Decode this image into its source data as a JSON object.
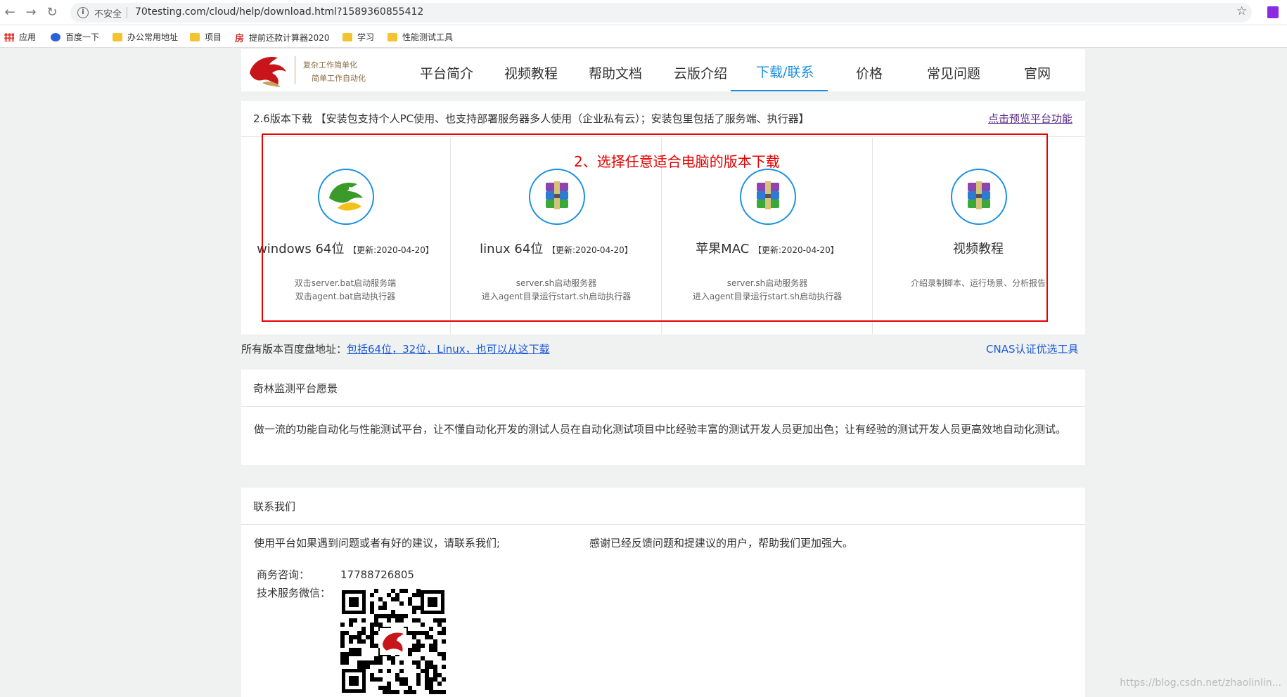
{
  "browser": {
    "security_label": "不安全",
    "url": "70testing.com/cloud/help/download.html?1589360855412"
  },
  "bookmarks": [
    {
      "label": "应用",
      "icon": "apps-grid-icon"
    },
    {
      "label": "百度一下",
      "icon": "baidu-paw-icon"
    },
    {
      "label": "办公常用地址",
      "icon": "folder-icon"
    },
    {
      "label": "项目",
      "icon": "folder-icon"
    },
    {
      "label": "提前还款计算器2020",
      "icon": "fang-icon"
    },
    {
      "label": "学习",
      "icon": "folder-icon"
    },
    {
      "label": "性能测试工具",
      "icon": "folder-icon"
    }
  ],
  "logo": {
    "line1": "复杂工作简单化",
    "line2": "简单工作自动化"
  },
  "nav": [
    "平台简介",
    "视频教程",
    "帮助文档",
    "云版介绍",
    "下载/联系",
    "价格",
    "常见问题",
    "官网"
  ],
  "download": {
    "header_text": "2.6版本下载 【安装包支持个人PC使用、也支持部署服务器多人使用（企业私有云）；安装包里包括了服务端、执行器】",
    "preview_link": "点击预览平台功能",
    "annotation": "2、选择任意适合电脑的版本下载",
    "items": [
      {
        "name": "windows 64位",
        "update": "【更新:2020-04-20】",
        "desc1": "双击server.bat启动服务端",
        "desc2": "双击agent.bat启动执行器",
        "icon": "dragon-logo-icon"
      },
      {
        "name": "linux 64位",
        "update": "【更新:2020-04-20】",
        "desc1": "server.sh启动服务器",
        "desc2": "进入agent目录运行start.sh启动执行器",
        "icon": "winrar-archive-icon"
      },
      {
        "name": "苹果MAC",
        "update": "【更新:2020-04-20】",
        "desc1": "server.sh启动服务器",
        "desc2": "进入agent目录运行start.sh启动执行器",
        "icon": "winrar-archive-icon"
      },
      {
        "name": "视频教程",
        "update": "",
        "desc1": "介绍录制脚本、运行场景、分析报告",
        "desc2": "",
        "icon": "winrar-archive-icon"
      }
    ]
  },
  "baidu": {
    "label": "所有版本百度盘地址：",
    "link": "包括64位，32位，Linux，也可以从这下载"
  },
  "cnas_link": "CNAS认证优选工具",
  "vision": {
    "title": "奇林监测平台愿景",
    "text": "做一流的功能自动化与性能测试平台，让不懂自动化开发的测试人员在自动化测试项目中比经验丰富的测试开发人员更加出色；让有经验的测试开发人员更高效地自动化测试。"
  },
  "contact": {
    "title": "联系我们",
    "intro": "使用平台如果遇到问题或者有好的建议，请联系我们;",
    "thanks": "感谢已经反馈问题和提建议的用户，帮助我们更加强大。",
    "business_label": "商务咨询：",
    "business_phone": "17788726805",
    "wechat_label": "技术服务微信："
  },
  "watermark": "https://blog.csdn.net/zhaolinlin...",
  "colors": {
    "accent": "#1a90e0",
    "annotation_red": "#e60000",
    "link_blue": "#1a58d8"
  }
}
